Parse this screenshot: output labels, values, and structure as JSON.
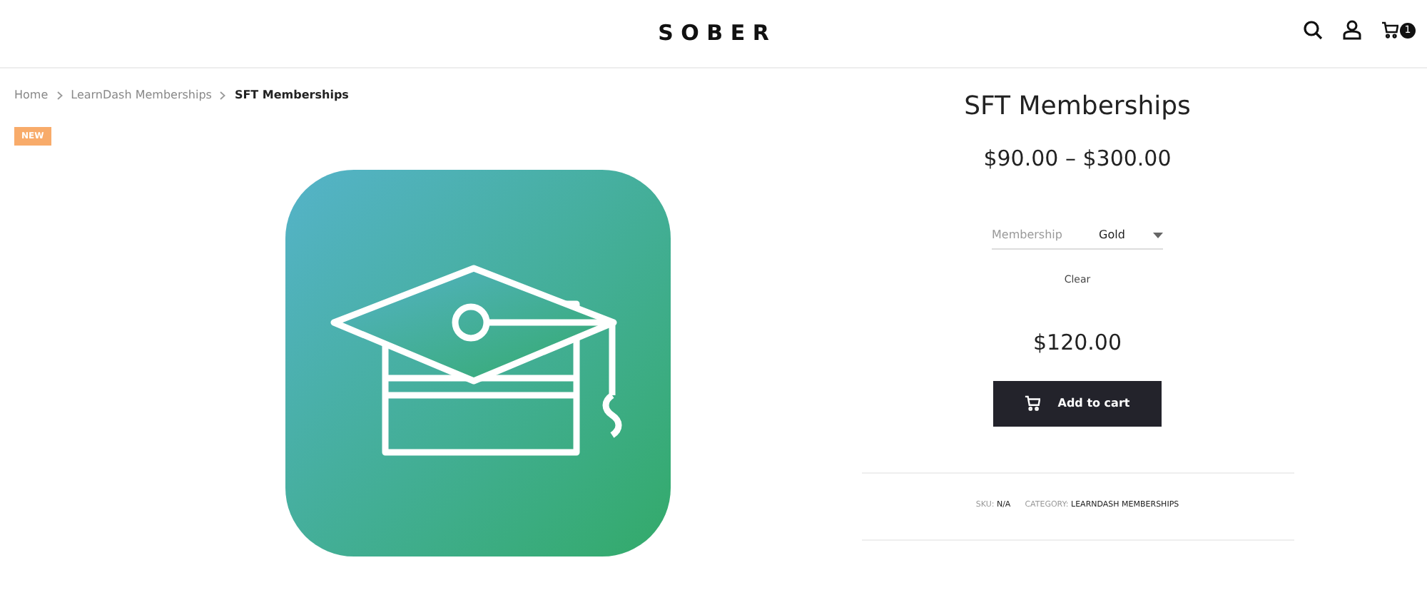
{
  "header": {
    "logo": "SOBER",
    "cart_count": "1"
  },
  "breadcrumb": [
    {
      "label": "Home",
      "current": false
    },
    {
      "label": "LearnDash Memberships",
      "current": false
    },
    {
      "label": "SFT Memberships",
      "current": true
    }
  ],
  "badge": "NEW",
  "product": {
    "title": "SFT Memberships",
    "price_range": "$90.00 – $300.00",
    "variation": {
      "label": "Membership",
      "value": "Gold"
    },
    "clear": "Clear",
    "price": "$120.00",
    "button": "Add to cart",
    "meta": {
      "sku_label": "SKU:",
      "sku": "N/A",
      "category_label": "CATEGORY:",
      "category": "LEARNDASH MEMBERSHIPS"
    }
  }
}
